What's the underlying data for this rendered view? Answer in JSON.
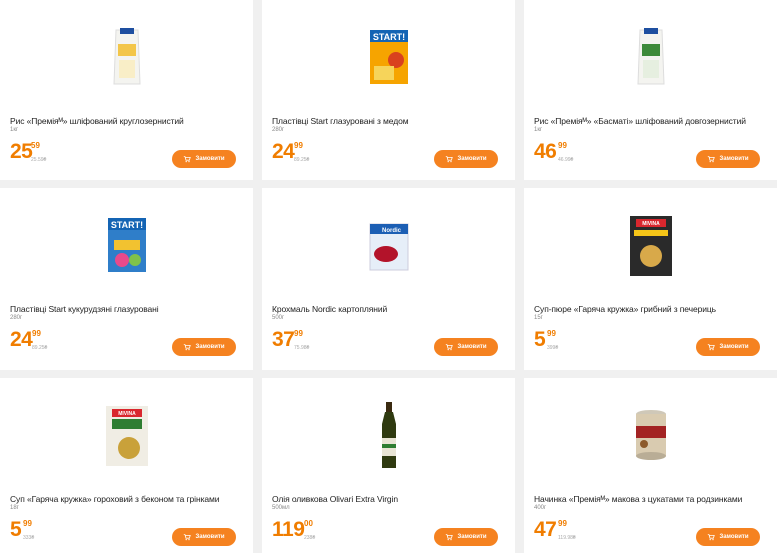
{
  "products": [
    {
      "title": "Рис «Преміяᴹ» шліфований круглозернистий",
      "weight": "1кг",
      "price_int": "25",
      "price_frac": "59",
      "unit": "25.59₴",
      "button": "Замовити",
      "icon": "rice-package-icon"
    },
    {
      "title": "Пластівці Start глазуровані з медом",
      "weight": "280г",
      "price_int": "24",
      "price_frac": "99",
      "unit": "89.25₴",
      "button": "Замовити",
      "icon": "cereal-box-icon"
    },
    {
      "title": "Рис «Преміяᴹ» «Басматі» шліфований довгозернистий",
      "weight": "1кг",
      "price_int": "46",
      "price_frac": "99",
      "unit": "46.99₴",
      "button": "Замовити",
      "icon": "rice-package-icon"
    },
    {
      "title": "Пластівці Start кукурудзяні глазуровані",
      "weight": "280г",
      "price_int": "24",
      "price_frac": "99",
      "unit": "89.25₴",
      "button": "Замовити",
      "icon": "cereal-box-icon"
    },
    {
      "title": "Крохмаль Nordic картопляний",
      "weight": "500г",
      "price_int": "37",
      "price_frac": "99",
      "unit": "75.98₴",
      "button": "Замовити",
      "icon": "starch-package-icon"
    },
    {
      "title": "Суп-пюре «Гаряча кружка» грибний з печериць",
      "weight": "15г",
      "price_int": "5",
      "price_frac": "99",
      "unit": "399₴",
      "button": "Замовити",
      "icon": "soup-sachet-icon"
    },
    {
      "title": "Суп «Гаряча кружка» гороховий з беконом та грінками",
      "weight": "18г",
      "price_int": "5",
      "price_frac": "99",
      "unit": "333₴",
      "button": "Замовити",
      "icon": "soup-sachet-icon"
    },
    {
      "title": "Олія оливкова Olivari Extra Virgin",
      "weight": "500мл",
      "price_int": "119",
      "price_frac": "00",
      "unit": "238₴",
      "button": "Замовити",
      "icon": "olive-oil-bottle-icon"
    },
    {
      "title": "Начинка «Преміяᴹ» макова з цукатами та родзинками",
      "weight": "400г",
      "price_int": "47",
      "price_frac": "99",
      "unit": "119.98₴",
      "button": "Замовити",
      "icon": "filling-can-icon"
    }
  ],
  "colors": {
    "accent": "#f58220",
    "price": "#f07d00"
  }
}
